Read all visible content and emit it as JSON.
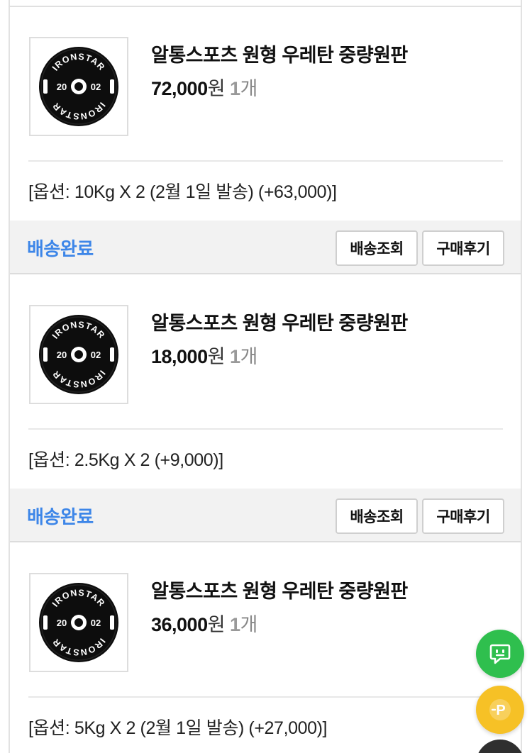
{
  "orders": [
    {
      "product_name": "알통스포츠 원형 우레탄 중량원판",
      "price": "72,000",
      "currency": "원",
      "quantity": "1",
      "quantity_unit": "개",
      "option": "[옵션: 10Kg X 2 (2월 1일 발송) (+63,000)]",
      "status": "배송완료",
      "track_label": "배송조회",
      "review_label": "구매후기"
    },
    {
      "product_name": "알통스포츠 원형 우레탄 중량원판",
      "price": "18,000",
      "currency": "원",
      "quantity": "1",
      "quantity_unit": "개",
      "option": "[옵션: 2.5Kg X 2 (+9,000)]",
      "status": "배송완료",
      "track_label": "배송조회",
      "review_label": "구매후기"
    },
    {
      "product_name": "알통스포츠 원형 우레탄 중량원판",
      "price": "36,000",
      "currency": "원",
      "quantity": "1",
      "quantity_unit": "개",
      "option": "[옵션: 5Kg X 2 (2월 1일 발송) (+27,000)]"
    }
  ],
  "product_image": {
    "brand_text": "IRONSTAR",
    "year_left": "20",
    "year_right": "02",
    "icon": "weight-plate-image"
  },
  "floating_buttons": [
    {
      "icon": "chat-icon",
      "color": "#2fbf4e"
    },
    {
      "icon": "point-icon",
      "label": "P",
      "color": "#f6c126"
    },
    {
      "icon": "more-icon",
      "color": "#2f2f2f"
    }
  ],
  "colors": {
    "status": "#3d86e8",
    "status_bar_bg": "#f2f2f2"
  }
}
